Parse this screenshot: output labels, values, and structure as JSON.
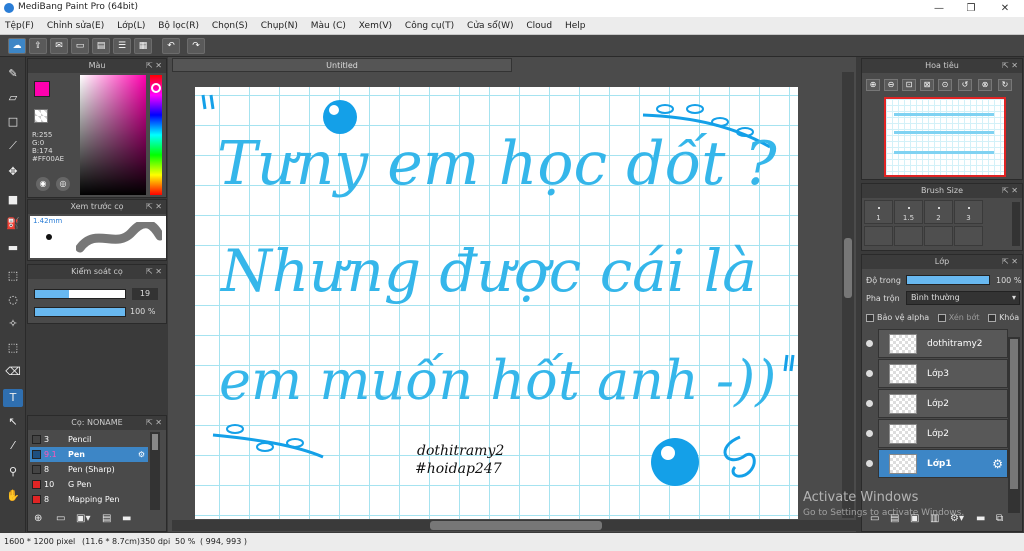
{
  "window": {
    "title": "MediBang Paint Pro (64bit)",
    "min": "—",
    "max": "❐",
    "close": "✕"
  },
  "menu": [
    "Tệp(F)",
    "Chỉnh sửa(E)",
    "Lớp(L)",
    "Bộ lọc(R)",
    "Chọn(S)",
    "Chụp(N)",
    "Màu (C)",
    "Xem(V)",
    "Công cụ(T)",
    "Cửa sổ(W)",
    "Cloud",
    "Help"
  ],
  "toolbar": {
    "undo": "↶",
    "redo": "↷"
  },
  "tools": [
    "brush-icon",
    "eraser-icon",
    "rectangle-icon",
    "line-icon",
    "move-icon",
    "fill-rect-icon",
    "bucket-icon",
    "gradient-icon",
    "select-rect-icon",
    "lasso-icon",
    "magic-wand-icon",
    "select-pen-icon",
    "select-eraser-icon",
    "text-icon",
    "operation-icon",
    "eyedropper-icon",
    "dropper-icon",
    "hand-icon"
  ],
  "color_panel": {
    "title": "Màu",
    "r": "R:255",
    "g": "G:0",
    "b": "B:174",
    "hex": "#FF00AE",
    "primary": "#ff00ae",
    "secondary": "#ffffff"
  },
  "brush_preview": {
    "title": "Xem trước cọ",
    "size": "1.42mm"
  },
  "brush_control": {
    "title": "Kiểm soát cọ",
    "size_value": "19",
    "opacity_value": "100 %"
  },
  "brush_list": {
    "title": "Cọ: NONAME",
    "items": [
      {
        "size": "3",
        "name": "Pencil",
        "color": "#444444"
      },
      {
        "size": "9.1",
        "name": "Pen",
        "color": "#1e4f80"
      },
      {
        "size": "8",
        "name": "Pen (Sharp)",
        "color": "#444444"
      },
      {
        "size": "10",
        "name": "G Pen",
        "color": "#e02424"
      },
      {
        "size": "8",
        "name": "Mapping Pen",
        "color": "#e02424"
      }
    ]
  },
  "document": {
    "tab": "Untitled"
  },
  "artwork": {
    "line1": "Tưny em học dốt ?",
    "line2": "Nhưng được cái là",
    "line3": "em muốn hốt anh -))",
    "sig1": "dothitramy2",
    "sig2": "#hoidap247"
  },
  "navigator": {
    "title": "Hoa tiêu"
  },
  "brush_size": {
    "title": "Brush Size",
    "values": [
      "1",
      "1.5",
      "2",
      "3"
    ]
  },
  "layers": {
    "title": "Lớp",
    "opacity_label": "Độ trong",
    "opacity_value": "100 %",
    "opacity_fraction": 1.0,
    "blend_label": "Pha trộn",
    "blend_value": "Bình thường",
    "protect_alpha": "Bảo vệ alpha",
    "clip": "Xén bớt",
    "lock": "Khóa",
    "items": [
      "dothitramy2",
      "Lớp3",
      "Lớp2",
      "Lớp2",
      "Lớp1"
    ]
  },
  "activate": {
    "title": "Activate Windows",
    "subtitle": "Go to Settings to activate Windows."
  },
  "status": {
    "size": "1600 * 1200 pixel",
    "cm": "(11.6 * 8.7cm)",
    "dpi": "350 dpi",
    "zoom": "50 %",
    "coords": "( 994, 993 )"
  }
}
